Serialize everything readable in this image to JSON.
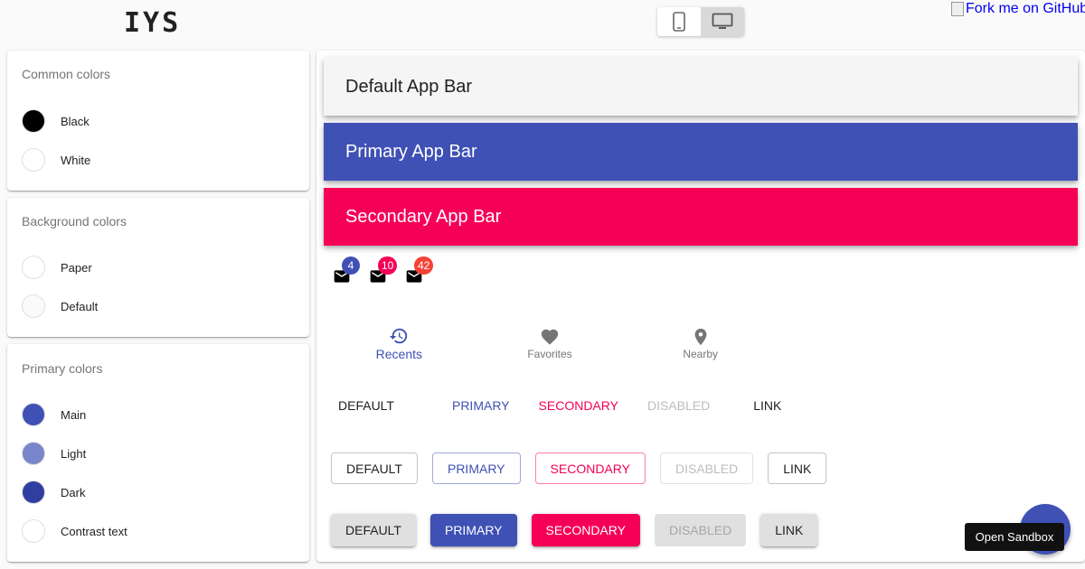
{
  "header": {
    "logo": "IYS",
    "fork_text": "Fork me on GitHub",
    "device_icons": [
      "phone-icon",
      "desktop-icon"
    ],
    "active_device": "desktop"
  },
  "palette_cards": [
    {
      "title": "Common colors",
      "swatches": [
        {
          "label": "Black",
          "color": "#000000"
        },
        {
          "label": "White",
          "color": "#ffffff"
        }
      ]
    },
    {
      "title": "Background colors",
      "swatches": [
        {
          "label": "Paper",
          "color": "#ffffff"
        },
        {
          "label": "Default",
          "color": "#fafafa"
        }
      ]
    },
    {
      "title": "Primary colors",
      "swatches": [
        {
          "label": "Main",
          "color": "#3f51b5"
        },
        {
          "label": "Light",
          "color": "#7986cb"
        },
        {
          "label": "Dark",
          "color": "#303f9f"
        },
        {
          "label": "Contrast text",
          "color": "#ffffff"
        }
      ]
    }
  ],
  "app_bars": [
    {
      "label": "Default App Bar",
      "bg": "#f5f5f5",
      "fg": "#212121"
    },
    {
      "label": "Primary App Bar",
      "bg": "#3f51b5",
      "fg": "#ffffff"
    },
    {
      "label": "Secondary App Bar",
      "bg": "#f50057",
      "fg": "#ffffff"
    }
  ],
  "badges": [
    {
      "count": "4",
      "color": "#3f51b5",
      "icon": "mail-icon"
    },
    {
      "count": "10",
      "color": "#f50057",
      "icon": "mail-icon"
    },
    {
      "count": "42",
      "color": "#f44336",
      "icon": "mail-icon"
    }
  ],
  "bottom_nav": [
    {
      "label": "Recents",
      "icon": "restore-icon",
      "active": true
    },
    {
      "label": "Favorites",
      "icon": "heart-icon",
      "active": false
    },
    {
      "label": "Nearby",
      "icon": "location-pin-icon",
      "active": false
    }
  ],
  "buttons": {
    "text": [
      {
        "label": "Default",
        "color": "#212121"
      },
      {
        "label": "Primary",
        "color": "#3f51b5"
      },
      {
        "label": "Secondary",
        "color": "#f50057"
      },
      {
        "label": "Disabled",
        "color": "#bdbdbd"
      },
      {
        "label": "Link",
        "color": "#212121"
      }
    ],
    "outlined": [
      {
        "label": "Default",
        "color": "#212121",
        "border": "rgba(0,0,0,0.23)"
      },
      {
        "label": "Primary",
        "color": "#3f51b5",
        "border": "rgba(63,81,181,0.5)"
      },
      {
        "label": "Secondary",
        "color": "#f50057",
        "border": "rgba(245,0,87,0.5)"
      },
      {
        "label": "Disabled",
        "color": "#bdbdbd",
        "border": "rgba(0,0,0,0.12)"
      },
      {
        "label": "Link",
        "color": "#212121",
        "border": "rgba(0,0,0,0.23)"
      }
    ],
    "contained": [
      {
        "label": "Default",
        "color": "#212121",
        "bg": "#e0e0e0"
      },
      {
        "label": "Primary",
        "color": "#ffffff",
        "bg": "#3f51b5"
      },
      {
        "label": "Secondary",
        "color": "#ffffff",
        "bg": "#f50057"
      },
      {
        "label": "Disabled",
        "color": "#a6a6a6",
        "bg": "#e0e0e0"
      },
      {
        "label": "Link",
        "color": "#212121",
        "bg": "#e0e0e0"
      }
    ]
  },
  "fab": {
    "color": "#3f51b5",
    "tooltip": "Open Sandbox"
  }
}
